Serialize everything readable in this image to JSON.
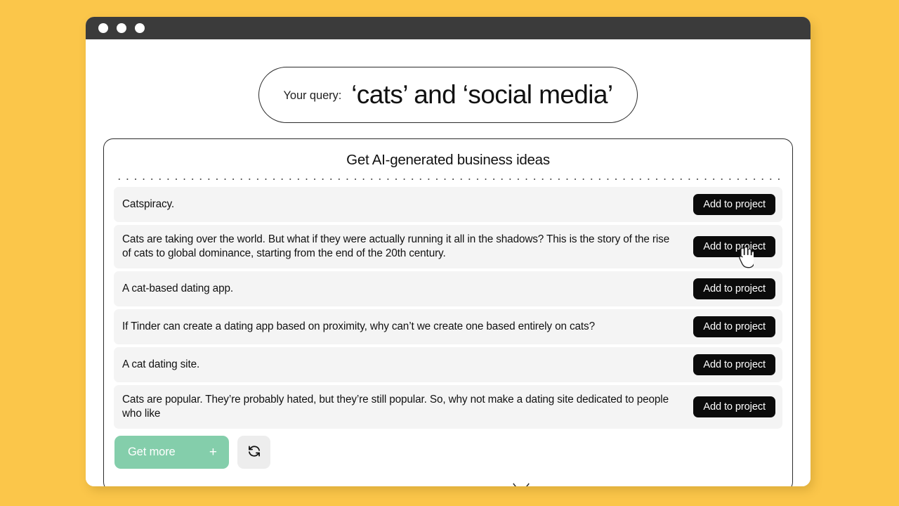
{
  "window": {
    "traffic_lights": [
      "close",
      "minimize",
      "maximize"
    ]
  },
  "query": {
    "label": "Your query:",
    "value": "‘cats’ and ‘social media’"
  },
  "card": {
    "title": "Get AI-generated business ideas",
    "ideas": [
      {
        "text": "Catspiracy.",
        "button_label": "Add to project",
        "tall": false
      },
      {
        "text": "Cats are taking over the world. But what if they were actually running it all in the shadows? This is the story of the rise of cats to global dominance, starting from the end of the 20th century.",
        "button_label": "Add to project",
        "tall": true
      },
      {
        "text": "A cat-based dating app.",
        "button_label": "Add to project",
        "tall": false
      },
      {
        "text": "If Tinder can create a dating app based on proximity, why can’t we create one based entirely on cats?",
        "button_label": "Add to project",
        "tall": false
      },
      {
        "text": "A cat dating site.",
        "button_label": "Add to project",
        "tall": false
      },
      {
        "text": "Cats are popular. They’re probably hated, but they’re still popular. So, why not make a dating site dedicated to people who like",
        "button_label": "Add to project",
        "tall": true
      }
    ],
    "actions": {
      "get_more_label": "Get more",
      "get_more_icon": "plus-icon",
      "refresh_icon": "refresh-icon"
    }
  },
  "colors": {
    "page_background": "#fbc64a",
    "titlebar": "#3b3b3b",
    "row_background": "#f4f4f4",
    "add_button": "#0b0b0b",
    "get_more_button": "#84ceab",
    "refresh_button": "#ededed"
  }
}
